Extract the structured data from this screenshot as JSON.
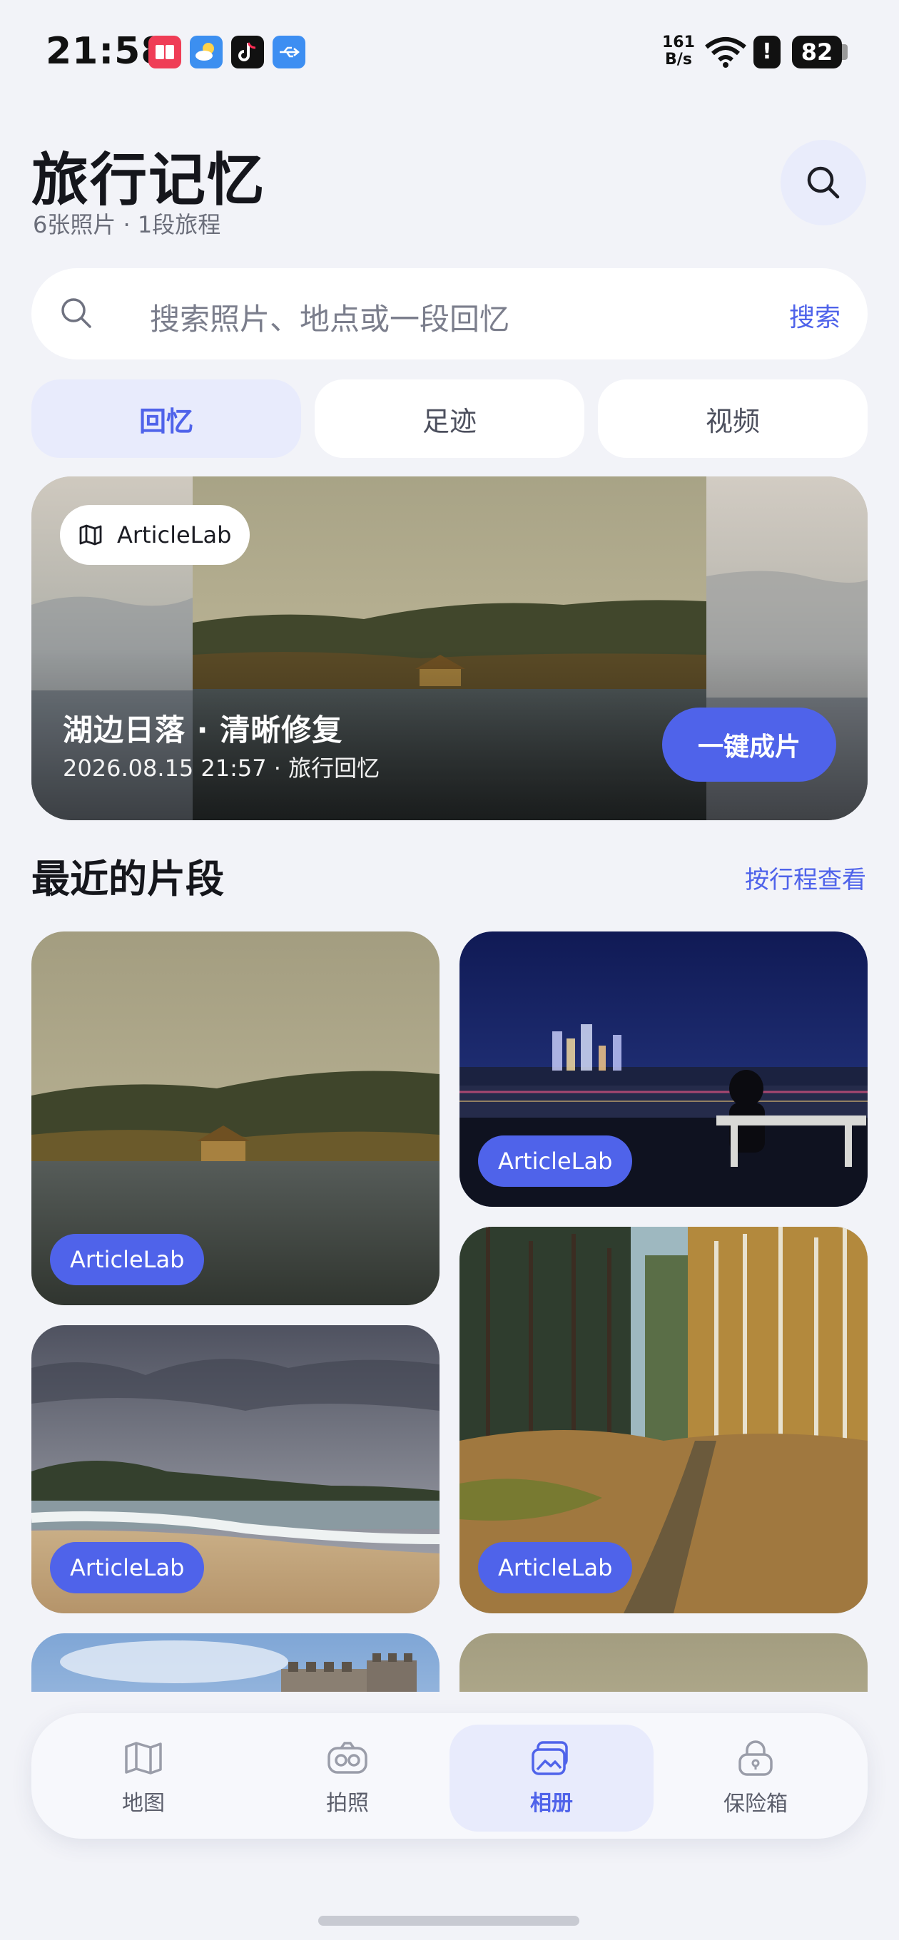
{
  "status_bar": {
    "time": "21:58",
    "net_speed_top": "161",
    "net_speed_bottom": "B/s",
    "alert_icon": "!",
    "battery": "82",
    "app_icons": [
      "reading-app-icon",
      "weather-app-icon",
      "tiktok-app-icon",
      "usb-icon"
    ]
  },
  "header": {
    "title": "旅行记忆",
    "subtitle": "6张照片 · 1段旅程",
    "search_icon": "search-icon"
  },
  "search": {
    "placeholder": "搜索照片、地点或一段回忆",
    "button_label": "搜索"
  },
  "tabs": [
    {
      "label": "回忆",
      "active": true
    },
    {
      "label": "足迹",
      "active": false
    },
    {
      "label": "视频",
      "active": false
    }
  ],
  "featured": {
    "chip_icon": "map-icon",
    "chip_label": "ArticleLab",
    "title": "湖边日落 · 清晰修复",
    "meta": "2026.08.15 21:57 · 旅行回忆",
    "action_label": "一键成片"
  },
  "recent": {
    "title": "最近的片段",
    "link_label": "按行程查看",
    "tiles": [
      {
        "label": "ArticleLab",
        "scene": "lake-sunset"
      },
      {
        "label": "ArticleLab",
        "scene": "city-night"
      },
      {
        "label": "ArticleLab",
        "scene": "beach"
      },
      {
        "label": "ArticleLab",
        "scene": "forest"
      },
      {
        "label": "",
        "scene": "great-wall"
      },
      {
        "label": "",
        "scene": "lake-sunset"
      }
    ]
  },
  "bottom_nav": [
    {
      "label": "地图",
      "icon": "map-icon",
      "active": false
    },
    {
      "label": "拍照",
      "icon": "camera-icon",
      "active": false
    },
    {
      "label": "相册",
      "icon": "album-icon",
      "active": true
    },
    {
      "label": "保险箱",
      "icon": "vault-icon",
      "active": false
    }
  ],
  "colors": {
    "accent": "#4f63ea",
    "accent_soft": "#e8ebfc",
    "background": "#f2f3f8"
  }
}
